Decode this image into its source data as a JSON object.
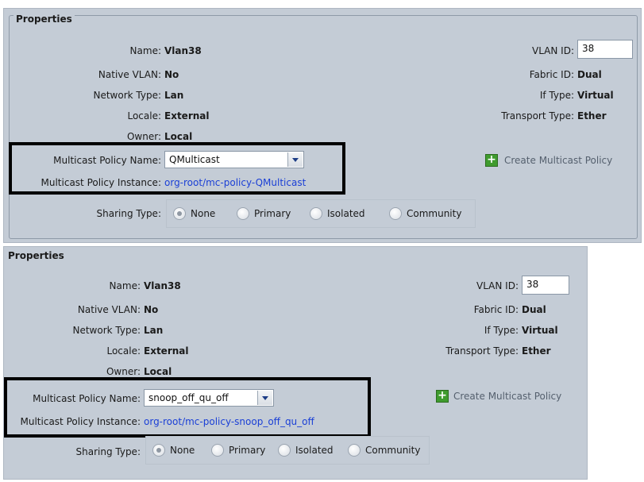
{
  "panels": [
    {
      "title": "Properties",
      "name_label": "Name:",
      "name_value": "Vlan38",
      "native_vlan_label": "Native VLAN:",
      "native_vlan_value": "No",
      "network_type_label": "Network Type:",
      "network_type_value": "Lan",
      "locale_label": "Locale:",
      "locale_value": "External",
      "owner_label": "Owner:",
      "owner_value": "Local",
      "multicast_policy_name_label": "Multicast Policy Name:",
      "multicast_policy_name_value": "QMulticast",
      "multicast_policy_instance_label": "Multicast Policy Instance:",
      "multicast_policy_instance_value": "org-root/mc-policy-QMulticast",
      "sharing_type_label": "Sharing Type:",
      "sharing_options": [
        "None",
        "Primary",
        "Isolated",
        "Community"
      ],
      "sharing_selected": "None",
      "vlan_id_label": "VLAN ID:",
      "vlan_id_value": "38",
      "fabric_id_label": "Fabric ID:",
      "fabric_id_value": "Dual",
      "if_type_label": "If Type:",
      "if_type_value": "Virtual",
      "transport_type_label": "Transport Type:",
      "transport_type_value": "Ether",
      "create_multicast_policy": "Create Multicast Policy"
    },
    {
      "title": "Properties",
      "name_label": "Name:",
      "name_value": "Vlan38",
      "native_vlan_label": "Native VLAN:",
      "native_vlan_value": "No",
      "network_type_label": "Network Type:",
      "network_type_value": "Lan",
      "locale_label": "Locale:",
      "locale_value": "External",
      "owner_label": "Owner:",
      "owner_value": "Local",
      "multicast_policy_name_label": "Multicast Policy Name:",
      "multicast_policy_name_value": "snoop_off_qu_off",
      "multicast_policy_instance_label": "Multicast Policy Instance:",
      "multicast_policy_instance_value": "org-root/mc-policy-snoop_off_qu_off",
      "sharing_type_label": "Sharing Type:",
      "sharing_options": [
        "None",
        "Primary",
        "Isolated",
        "Community"
      ],
      "sharing_selected": "None",
      "vlan_id_label": "VLAN ID:",
      "vlan_id_value": "38",
      "fabric_id_label": "Fabric ID:",
      "fabric_id_value": "Dual",
      "if_type_label": "If Type:",
      "if_type_value": "Virtual",
      "transport_type_label": "Transport Type:",
      "transport_type_value": "Ether",
      "create_multicast_policy": "Create Multicast Policy"
    }
  ],
  "colors": {
    "panel_bg": "#c4ccd6",
    "link": "#1a3fd6",
    "highlight_border": "#000000",
    "add_icon": "#3f9b2e"
  },
  "icons": {
    "add": "plus-icon",
    "dropdown": "chevron-down-icon"
  }
}
